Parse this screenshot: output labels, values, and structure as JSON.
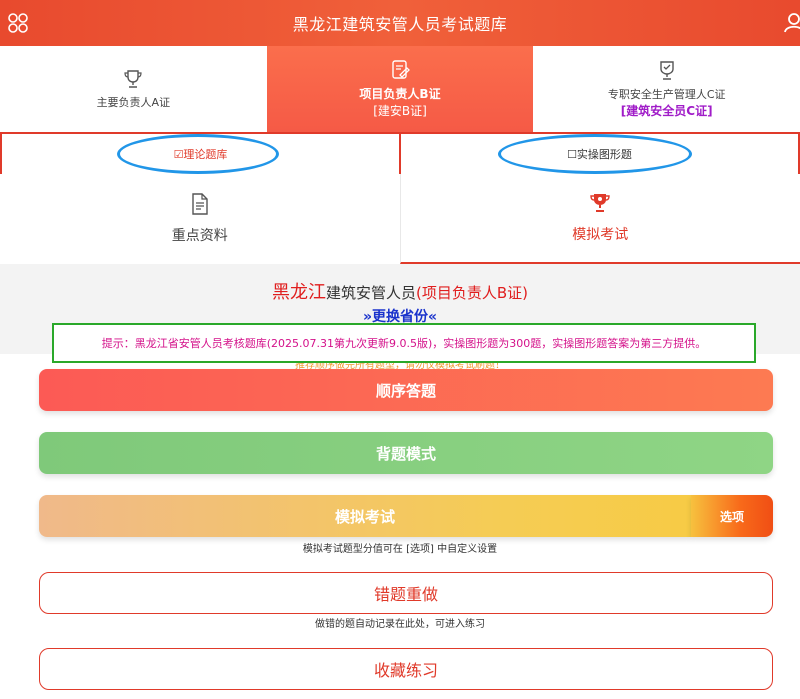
{
  "header": {
    "title": "黑龙江建筑安管人员考试题库"
  },
  "cert_tabs": [
    {
      "label": "主要负责人A证",
      "sub": ""
    },
    {
      "label": "项目负责人B证",
      "sub": "[建安B证]"
    },
    {
      "label": "专职安全生产管理人C证",
      "sub": "[建筑安全员C证]"
    }
  ],
  "bank": {
    "theory": "☑理论题库",
    "practical": "☐实操图形题"
  },
  "features": {
    "materials": "重点资料",
    "mock_exam": "模拟考试"
  },
  "info": {
    "province": "黑龙江",
    "middle": "建筑安管人员",
    "cert": "(项目负责人B证)",
    "change_province": "»更换省份«",
    "notice": "提示：黑龙江省安管人员考核题库(2025.07.31第九次更新9.0.5版)，实操图形题为300题，实操图形题答案为第三方提供。",
    "hint": "推荐顺序做完所有题型，请勿仅模拟考试刷题！"
  },
  "buttons": {
    "sequential": "顺序答题",
    "study_mode": "背题模式",
    "mock_exam": "模拟考试",
    "options": "选项",
    "mock_note": "模拟考试题型分值可在 [选项] 中自定义设置",
    "wrong_redo": "错题重做",
    "wrong_note": "做错的题自动记录在此处，可进入练习",
    "favorites": "收藏练习"
  },
  "colors": {
    "primary": "#e84a2e",
    "accent_red": "#e03a2a",
    "annotation_blue": "#2196e8",
    "notice_border": "#2aa82a",
    "notice_text": "#d4118a",
    "link_blue": "#1a33cc"
  }
}
